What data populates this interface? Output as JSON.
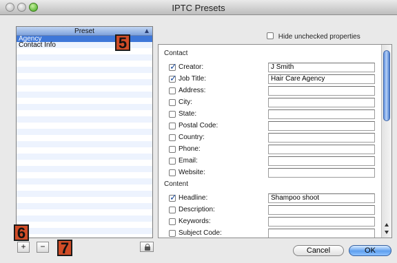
{
  "window": {
    "title": "IPTC Presets"
  },
  "colors": {
    "selection": "#3e77d8",
    "annotation_badge": "#d04c27",
    "ok_button": "#5fa0ef"
  },
  "preset_list": {
    "header": "Preset",
    "items": [
      {
        "label": "Agency",
        "selected": true
      },
      {
        "label": "Contact Info",
        "selected": false
      }
    ]
  },
  "badges": {
    "five": "5",
    "six": "6",
    "seven": "7"
  },
  "buttons": {
    "add": "+",
    "remove": "−",
    "cancel": "Cancel",
    "ok": "OK"
  },
  "icons": {
    "lock": "lock-icon",
    "checkmark": "checkmark-icon"
  },
  "hide_unchecked": {
    "label": "Hide unchecked properties",
    "checked": false
  },
  "sections": {
    "contact": {
      "title": "Contact",
      "properties": [
        {
          "label": "Creator:",
          "checked": true,
          "value": "J Smith"
        },
        {
          "label": "Job Title:",
          "checked": true,
          "value": "Hair Care Agency"
        },
        {
          "label": "Address:",
          "checked": false,
          "value": ""
        },
        {
          "label": "City:",
          "checked": false,
          "value": ""
        },
        {
          "label": "State:",
          "checked": false,
          "value": ""
        },
        {
          "label": "Postal Code:",
          "checked": false,
          "value": ""
        },
        {
          "label": "Country:",
          "checked": false,
          "value": ""
        },
        {
          "label": "Phone:",
          "checked": false,
          "value": ""
        },
        {
          "label": "Email:",
          "checked": false,
          "value": ""
        },
        {
          "label": "Website:",
          "checked": false,
          "value": ""
        }
      ]
    },
    "content": {
      "title": "Content",
      "properties": [
        {
          "label": "Headline:",
          "checked": true,
          "value": "Shampoo shoot"
        },
        {
          "label": "Description:",
          "checked": false,
          "value": ""
        },
        {
          "label": "Keywords:",
          "checked": false,
          "value": ""
        },
        {
          "label": "Subject Code:",
          "checked": false,
          "value": ""
        }
      ]
    }
  }
}
